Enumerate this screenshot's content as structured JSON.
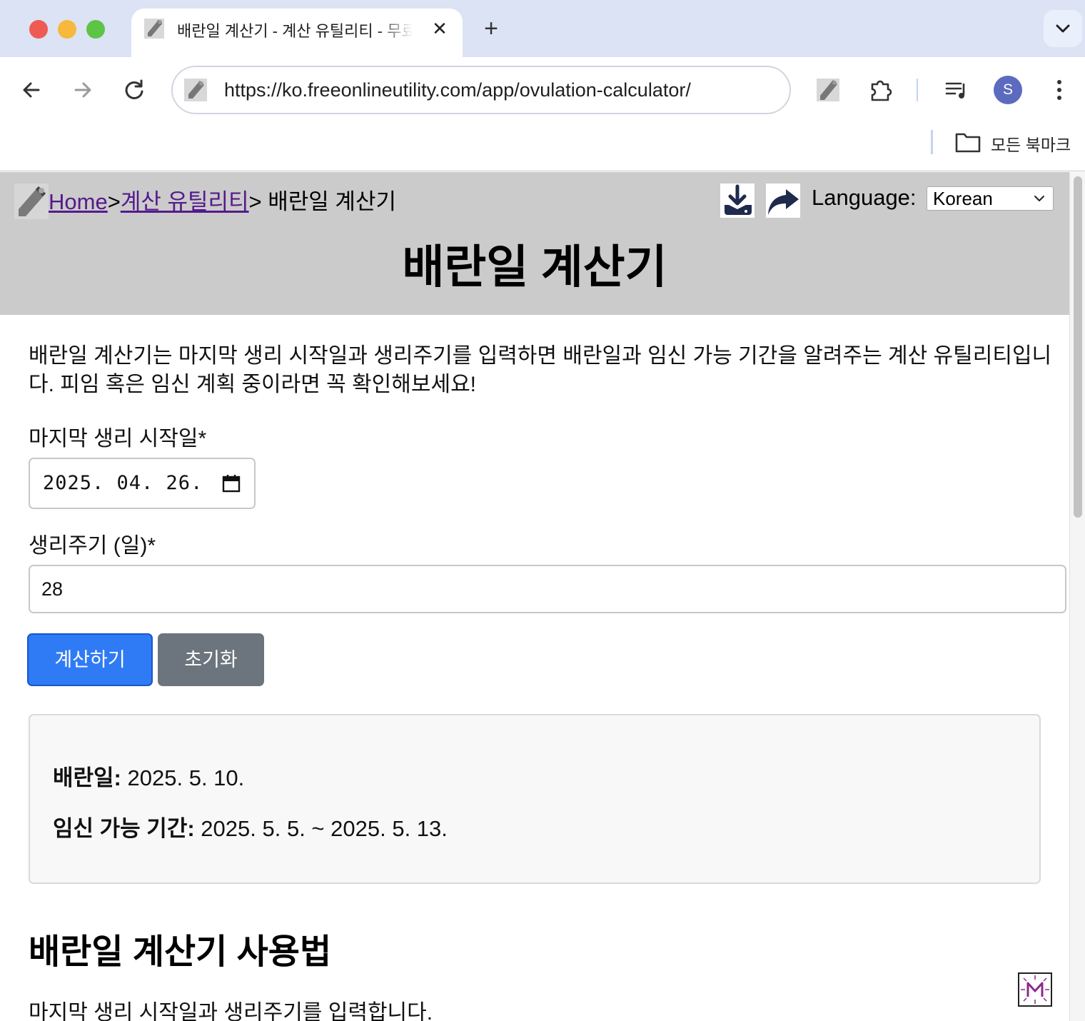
{
  "browser": {
    "tab_title": "배란일 계산기 - 계산 유틸리티 - 무료 온라인 유틸리티",
    "url": "https://ko.freeonlineutility.com/app/ovulation-calculator/",
    "avatar_letter": "S",
    "bookmarks_label": "모든 북마크",
    "new_tab_symbol": "+",
    "close_symbol": "✕"
  },
  "header": {
    "breadcrumb_home": "Home",
    "breadcrumb_sep1": ">",
    "breadcrumb_category": "계산 유틸리티",
    "breadcrumb_current": "> 배란일 계산기",
    "language_label": "Language:",
    "language_value": "Korean",
    "title": "배란일 계산기"
  },
  "main": {
    "intro": "배란일 계산기는 마지막 생리 시작일과 생리주기를 입력하면 배란일과 임신 가능 기간을 알려주는 계산 유틸리티입니다. 피임 혹은 임신 계획 중이라면 꼭 확인해보세요!",
    "last_period_label": "마지막 생리 시작일*",
    "last_period_value": "2025. 04. 26.",
    "cycle_label": "생리주기 (일)*",
    "cycle_value": "28",
    "calculate_button": "계산하기",
    "reset_button": "초기화",
    "result": {
      "ovulation_label": "배란일:",
      "ovulation_value": "2025. 5. 10.",
      "fertile_label": "임신 가능 기간:",
      "fertile_value": "2025. 5. 5. ~ 2025. 5. 13."
    },
    "howto_heading": "배란일 계산기 사용법",
    "howto_step1": "마지막 생리 시작일과 생리주기를 입력합니다."
  },
  "colors": {
    "primary_button": "#2f7bf5",
    "secondary_button": "#6c757d",
    "header_bg": "#cbcbcb",
    "link_visited": "#551a8b"
  }
}
